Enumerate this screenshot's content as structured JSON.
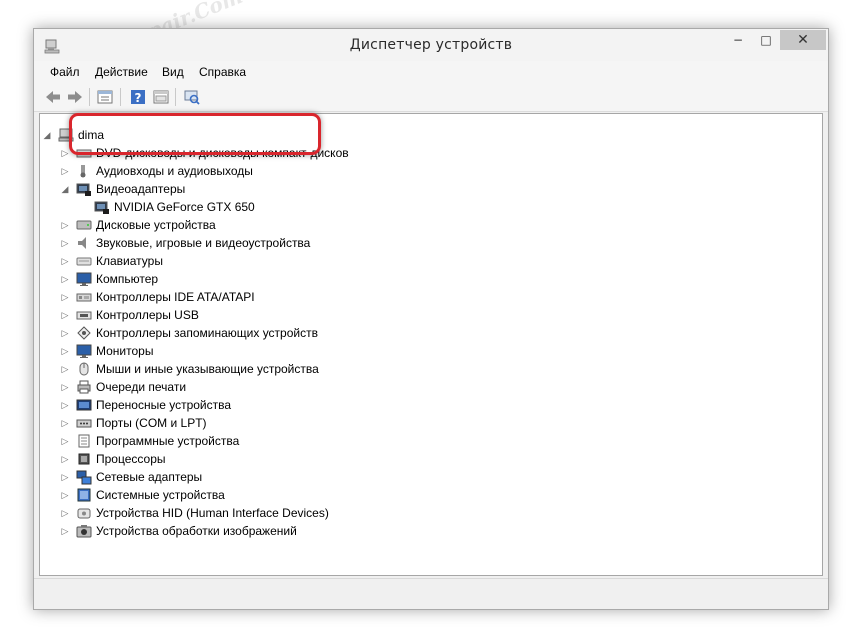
{
  "window": {
    "title": "Диспетчер устройств",
    "close_glyph": "✕",
    "min_glyph": "−",
    "max_glyph": "□"
  },
  "menu": [
    "Файл",
    "Действие",
    "Вид",
    "Справка"
  ],
  "toolbar": {
    "buttons": [
      "back-icon",
      "forward-icon",
      "properties-icon",
      "help-icon",
      "view-icon",
      "scan-hardware-icon"
    ]
  },
  "tree": {
    "root": "dima",
    "categories": [
      {
        "label": "DVD-дисководы и дисководы компакт-дисков",
        "icon": "dvd-icon",
        "expanded": false
      },
      {
        "label": "Аудиовходы и аудиовыходы",
        "icon": "audio-io-icon",
        "expanded": false
      },
      {
        "label": "Видеоадаптеры",
        "icon": "display-adapter-icon",
        "expanded": true,
        "children": [
          {
            "label": "NVIDIA GeForce GTX 650",
            "icon": "gpu-icon"
          }
        ]
      },
      {
        "label": "Дисковые устройства",
        "icon": "disk-icon",
        "expanded": false
      },
      {
        "label": "Звуковые, игровые и видеоустройства",
        "icon": "sound-icon",
        "expanded": false
      },
      {
        "label": "Клавиатуры",
        "icon": "keyboard-icon",
        "expanded": false
      },
      {
        "label": "Компьютер",
        "icon": "computer-icon",
        "expanded": false
      },
      {
        "label": "Контроллеры IDE ATA/ATAPI",
        "icon": "ide-icon",
        "expanded": false
      },
      {
        "label": "Контроллеры USB",
        "icon": "usb-icon",
        "expanded": false
      },
      {
        "label": "Контроллеры запоминающих устройств",
        "icon": "storage-icon",
        "expanded": false
      },
      {
        "label": "Мониторы",
        "icon": "monitor-icon",
        "expanded": false
      },
      {
        "label": "Мыши и иные указывающие устройства",
        "icon": "mouse-icon",
        "expanded": false
      },
      {
        "label": "Очереди печати",
        "icon": "printer-icon",
        "expanded": false
      },
      {
        "label": "Переносные устройства",
        "icon": "portable-icon",
        "expanded": false
      },
      {
        "label": "Порты (COM и LPT)",
        "icon": "port-icon",
        "expanded": false
      },
      {
        "label": "Программные устройства",
        "icon": "software-device-icon",
        "expanded": false
      },
      {
        "label": "Процессоры",
        "icon": "cpu-icon",
        "expanded": false
      },
      {
        "label": "Сетевые адаптеры",
        "icon": "network-icon",
        "expanded": false
      },
      {
        "label": "Системные устройства",
        "icon": "system-icon",
        "expanded": false
      },
      {
        "label": "Устройства HID (Human Interface Devices)",
        "icon": "hid-icon",
        "expanded": false
      },
      {
        "label": "Устройства обработки изображений",
        "icon": "imaging-icon",
        "expanded": false
      }
    ]
  },
  "watermark_text": "Soringpcrepair.Com",
  "colors": {
    "highlight": "#d9262d"
  }
}
